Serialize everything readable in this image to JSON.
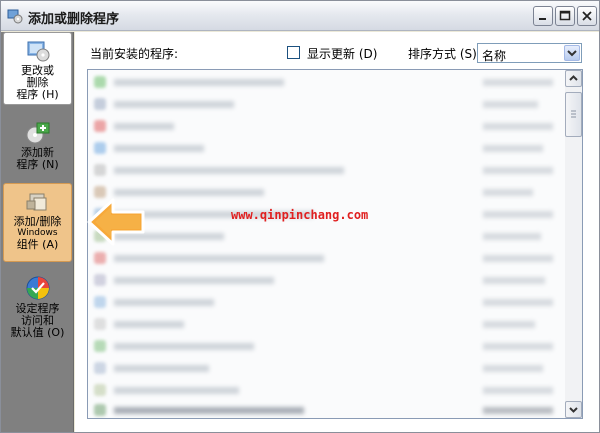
{
  "window": {
    "title": "添加或删除程序",
    "minimize_label": "minimize",
    "maximize_label": "maximize",
    "close_label": "close"
  },
  "sidebar": {
    "items": [
      {
        "label_lines": [
          "更改或",
          "删除",
          "程序 (H)"
        ],
        "icon": "change-remove-programs-icon",
        "state": "selected"
      },
      {
        "label_lines": [
          "添加新",
          "程序 (N)"
        ],
        "icon": "add-program-icon",
        "state": "normal"
      },
      {
        "label_lines": [
          "添加/删除",
          "Windows",
          "组件 (A)"
        ],
        "icon": "windows-components-icon",
        "state": "highlighted"
      },
      {
        "label_lines": [
          "设定程序",
          "访问和",
          "默认值 (O)"
        ],
        "icon": "program-defaults-icon",
        "state": "normal"
      }
    ]
  },
  "header": {
    "installed_label": "当前安装的程序:",
    "show_updates_label": "显示更新 (D)",
    "show_updates_checked": false,
    "sort_label": "排序方式 (S):",
    "sort_value": "名称"
  },
  "overlay": {
    "watermark": "www.qinpinchang.com",
    "accent": "#f5a623"
  }
}
